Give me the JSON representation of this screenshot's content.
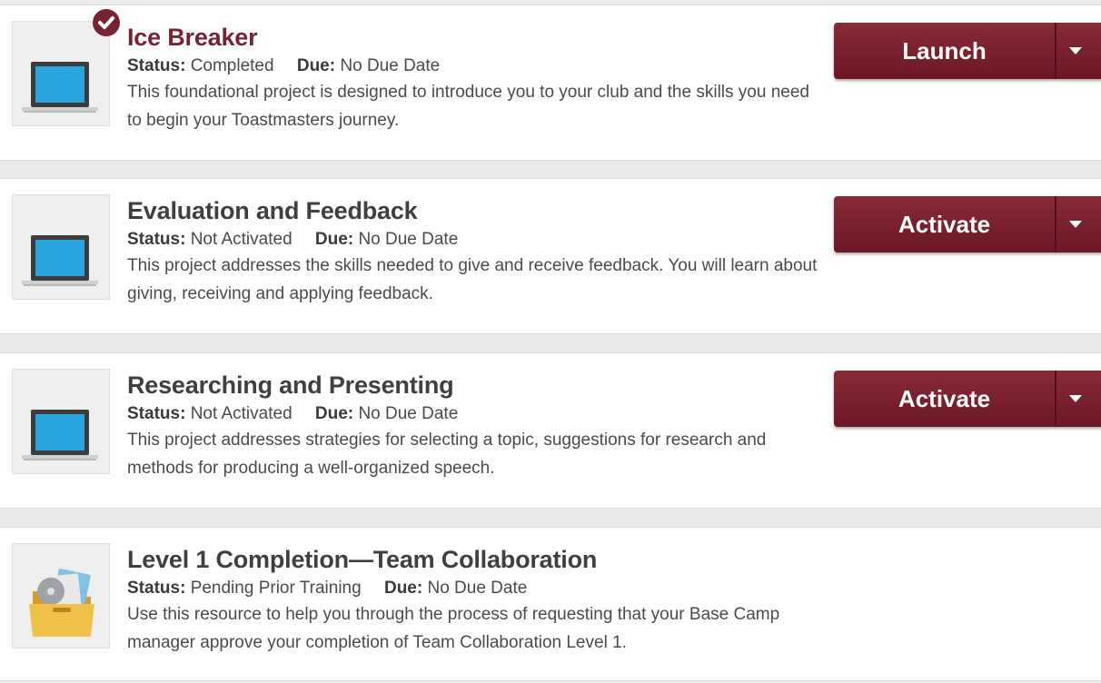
{
  "projects": [
    {
      "title": "Ice Breaker",
      "status_label": "Status:",
      "status": "Completed",
      "due_label": "Due:",
      "due": "No Due Date",
      "description": "This foundational project is designed to introduce you to your club and the skills you need to begin your Toastmasters journey.",
      "action": "Launch",
      "icon": "laptop-icon",
      "completed": true
    },
    {
      "title": "Evaluation and Feedback",
      "status_label": "Status:",
      "status": "Not Activated",
      "due_label": "Due:",
      "due": "No Due Date",
      "description": "This project addresses the skills needed to give and receive feedback. You will learn about giving, receiving and applying feedback.",
      "action": "Activate",
      "icon": "laptop-icon",
      "completed": false
    },
    {
      "title": "Researching and Presenting",
      "status_label": "Status:",
      "status": "Not Activated",
      "due_label": "Due:",
      "due": "No Due Date",
      "description": "This project addresses strategies for selecting a topic, suggestions for research and methods for producing a well-organized speech.",
      "action": "Activate",
      "icon": "laptop-icon",
      "completed": false
    },
    {
      "title": "Level 1 Completion—Team Collaboration",
      "status_label": "Status:",
      "status": "Pending Prior Training",
      "due_label": "Due:",
      "due": "No Due Date",
      "description": "Use this resource to help you through the process of requesting that your Base Camp manager approve your completion of Team Collaboration Level 1.",
      "icon": "folder-resource-icon",
      "completed": false
    }
  ],
  "colors": {
    "brand": "#772432",
    "button": "#7a1f2d",
    "screen": "#29a6e0"
  }
}
